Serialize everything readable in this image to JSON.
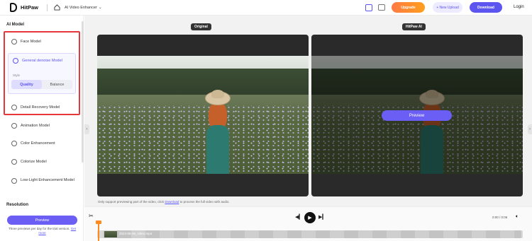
{
  "header": {
    "brand": "HitPaw",
    "breadcrumb": "AI Video Enhancer",
    "upgrade_label": "Upgrade",
    "new_upload_label": "+ New Upload",
    "download_label": "Download",
    "login_label": "Login",
    "accent_color": "#5c55f0",
    "upgrade_color": "#ff8a2a"
  },
  "sidebar": {
    "section_title": "AI Model",
    "models": [
      {
        "label": "Face Model",
        "icon": "face-icon"
      },
      {
        "label": "General denoise Model",
        "icon": "denoise-icon",
        "selected": true
      },
      {
        "label": "Detail Recovery Model",
        "icon": "gear-icon"
      },
      {
        "label": "Animation Model",
        "icon": "animation-icon"
      },
      {
        "label": "Color Enhancement",
        "icon": "color-icon"
      },
      {
        "label": "Colorize Model",
        "icon": "colorize-icon"
      },
      {
        "label": "Low-Light Enhancement Model",
        "icon": "lowlight-icon"
      }
    ],
    "style_label": "Style",
    "style_options": [
      "Quality",
      "Balance"
    ],
    "style_selected": "Quality",
    "resolution_title": "Resolution",
    "preview_label": "Preview",
    "preview_note": "Three previews per day for the trial version.",
    "get_more": "Get more"
  },
  "compare": {
    "original_label": "Original",
    "hitpaw_label": "HitPaw AI",
    "overlay_preview": "Preview"
  },
  "notice": {
    "text_before": "Only support previewing part of the video, click",
    "link": "Download",
    "text_after": "to process the full video with audio."
  },
  "player": {
    "time": "0:00 / 0:06",
    "clip_name": "2024-08-26_video.mp4"
  }
}
